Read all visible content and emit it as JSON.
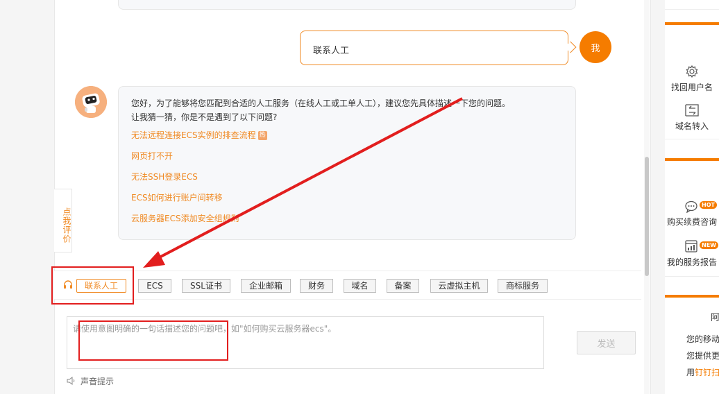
{
  "conversation": {
    "user_message": "联系人工",
    "user_avatar_label": "我",
    "bot_message": {
      "line1": "您好，为了能够将您匹配到合适的人工服务（在线人工或工单人工），建议您先具体描述一下您的问题。",
      "line2": "让我猜一猜，你是不是遇到了以下问题?",
      "links": [
        {
          "text": "无法远程连接ECS实例的排查流程",
          "badge": "热"
        },
        {
          "text": "网页打不开"
        },
        {
          "text": "无法SSH登录ECS"
        },
        {
          "text": "ECS如何进行账户间转移"
        },
        {
          "text": "云服务器ECS添加安全组规则"
        }
      ]
    }
  },
  "rate_tab": "点我评价",
  "quick_bar": {
    "human_label": "联系人工",
    "tags": [
      "ECS",
      "SSL证书",
      "企业邮箱",
      "财务",
      "域名",
      "备案",
      "云虚拟主机",
      "商标服务"
    ]
  },
  "input": {
    "placeholder": "请使用意图明确的一句话描述您的问题吧，如\"如何购买云服务器ecs\"。",
    "send_label": "发送",
    "sound_label": "声音提示"
  },
  "sidebar": {
    "items": [
      {
        "label": "找回用户名",
        "icon": "gear-icon"
      },
      {
        "label": "域名转入",
        "icon": "transfer-icon"
      },
      {
        "label": "购买续费咨询",
        "icon": "chat-icon",
        "badge": "HOT"
      },
      {
        "label": "我的服务报告",
        "icon": "report-icon",
        "badge": "NEW"
      }
    ],
    "partial": {
      "title": "阿",
      "line1": "您的移动",
      "line2": "您提供更",
      "line3_prefix": "用",
      "line3_accent": "钉钉扫"
    }
  },
  "colors": {
    "accent": "#f08a24",
    "avatar": "#f57c00",
    "annotation": "#e21e1e"
  }
}
